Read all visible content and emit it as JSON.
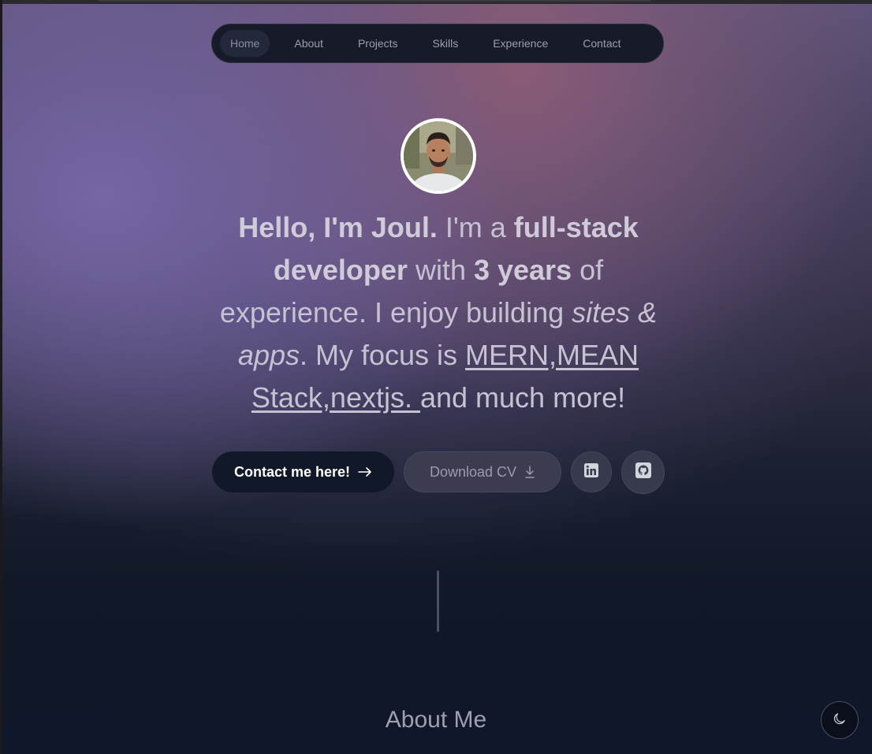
{
  "nav": {
    "items": [
      {
        "label": "Home",
        "active": true
      },
      {
        "label": "About"
      },
      {
        "label": "Projects"
      },
      {
        "label": "Skills"
      },
      {
        "label": "Experience"
      },
      {
        "label": "Contact"
      }
    ]
  },
  "hero": {
    "greeting": "Hello, I'm Joul.",
    "intro_1": " I'm a ",
    "role": "full-stack developer",
    "intro_2": " with ",
    "years": "3 years",
    "intro_3": " of experience. I enjoy building ",
    "building": "sites & apps",
    "intro_4": ". My focus is ",
    "focus": "MERN,MEAN Stack,nextjs. ",
    "intro_5": "and much more!"
  },
  "actions": {
    "contact_label": "Contact me here!",
    "download_label": "Download CV",
    "linkedin_icon": "linkedin-icon",
    "github_icon": "github-icon"
  },
  "about": {
    "heading": "About Me"
  },
  "theme_toggle": {
    "icon": "moon-icon"
  },
  "colors": {
    "primary_button": "#111827",
    "page_bg": "#111827",
    "secondary_button": "#3b3c4f"
  }
}
